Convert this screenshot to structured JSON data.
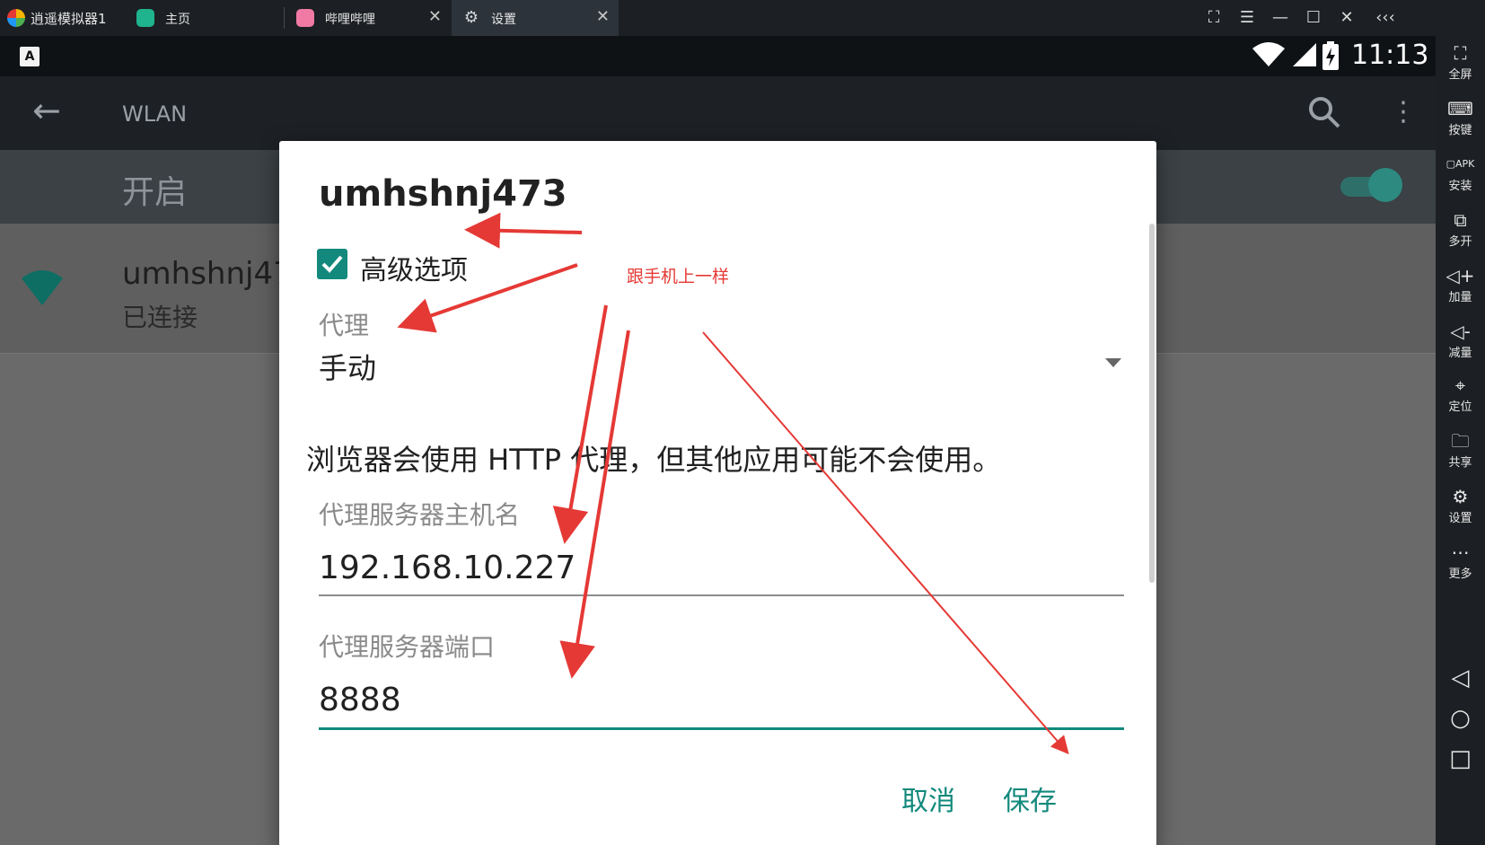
{
  "window": {
    "app_title": "逍遥模拟器1",
    "tabs": [
      {
        "label": "主页"
      },
      {
        "label": "哔哩哔哩"
      },
      {
        "label": "设置"
      }
    ]
  },
  "sidebar": {
    "items": [
      {
        "label": "全屏",
        "icon": "fullscreen-icon"
      },
      {
        "label": "按键",
        "icon": "keyboard-icon"
      },
      {
        "label": "安装",
        "icon": "apk-install-icon"
      },
      {
        "label": "多开",
        "icon": "multi-instance-icon"
      },
      {
        "label": "加量",
        "icon": "volume-up-icon"
      },
      {
        "label": "减量",
        "icon": "volume-down-icon"
      },
      {
        "label": "定位",
        "icon": "location-icon"
      },
      {
        "label": "共享",
        "icon": "folder-icon"
      },
      {
        "label": "设置",
        "icon": "gear-icon"
      },
      {
        "label": "更多",
        "icon": "more-icon"
      }
    ]
  },
  "statusbar": {
    "time": "11:13",
    "keyboard_indicator": "A"
  },
  "toolbar": {
    "title": "WLAN"
  },
  "wlan": {
    "switch_label": "开启",
    "network_name": "umhshnj47",
    "network_status": "已连接"
  },
  "dialog": {
    "title": "umhshnj473",
    "advanced_label": "高级选项",
    "proxy_label": "代理",
    "proxy_value": "手动",
    "notice": "浏览器会使用 HTTP 代理，但其他应用可能不会使用。",
    "host_label": "代理服务器主机名",
    "host_value": "192.168.10.227",
    "port_label": "代理服务器端口",
    "port_value": "8888",
    "cancel_label": "取消",
    "save_label": "保存"
  },
  "annotation": {
    "text": "跟手机上一样",
    "color": "#e53935"
  },
  "colors": {
    "accent": "#12897c",
    "annotation": "#e53935"
  }
}
